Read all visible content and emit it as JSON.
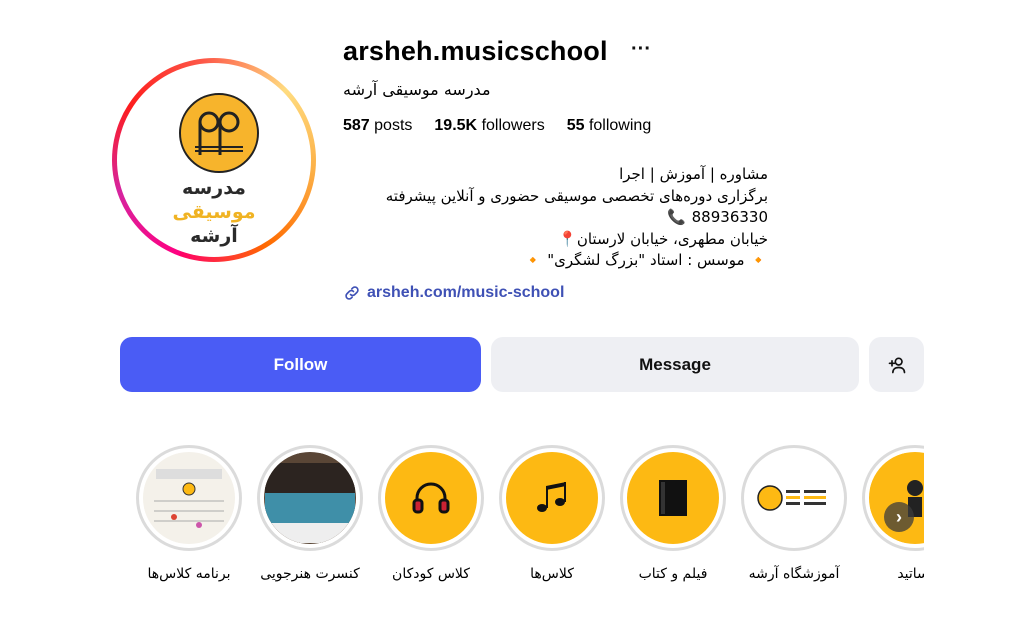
{
  "profile": {
    "username": "arsheh.musicschool",
    "full_name": "مدرسه موسیقی آرشه",
    "logo_text": [
      "مدرسه",
      "موسیقی",
      "آرشه"
    ]
  },
  "stats": {
    "posts_count": "587",
    "posts_label": "posts",
    "followers_count": "19.5K",
    "followers_label": "followers",
    "following_count": "55",
    "following_label": "following"
  },
  "bio": {
    "line1": "مشاوره | آموزش | اجرا",
    "line2": "برگزاری دوره‌های تخصصی موسیقی حضوری و آنلاین پیشرفته",
    "phone": "88936330",
    "address": "خیابان مطهری، خیابان لارستان",
    "founder": "موسس : استاد \"بزرگ لشگری\""
  },
  "link": {
    "text": "arsheh.com/music-school"
  },
  "buttons": {
    "follow": "Follow",
    "message": "Message"
  },
  "colors": {
    "follow_bg": "#4a5cf5",
    "link": "#3f51b5",
    "highlight_yellow": "#fdb913"
  },
  "highlights": [
    {
      "label": "برنامه کلاس‌ها",
      "icon": "schedule-thumbnail"
    },
    {
      "label": "کنسرت هنرجویی",
      "icon": "concert-hall-thumbnail"
    },
    {
      "label": "کلاس کودکان",
      "icon": "headphones-icon"
    },
    {
      "label": "کلاس‌ها",
      "icon": "music-notes-icon"
    },
    {
      "label": "فیلم و کتاب",
      "icon": "book-icon"
    },
    {
      "label": "آموزشگاه آرشه",
      "icon": "arsheh-logo-thumbnail"
    },
    {
      "label": "اساتید",
      "icon": "teacher-thumbnail"
    }
  ]
}
